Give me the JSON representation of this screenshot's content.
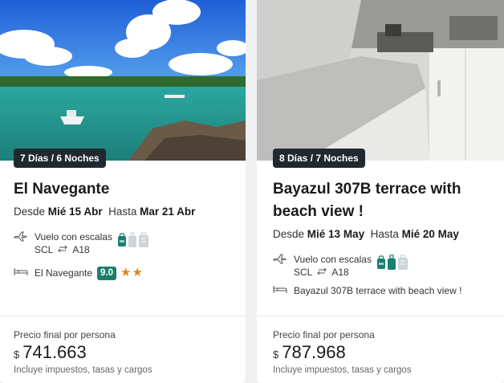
{
  "cards": [
    {
      "badge": "7 Días / 6 Noches",
      "title": "El Navegante",
      "dates": {
        "from_label": "Desde",
        "from_date": "Mié 15 Abr",
        "to_label": "Hasta",
        "to_date": "Mar 21 Abr"
      },
      "flight": {
        "label": "Vuelo con escalas",
        "origin": "SCL",
        "destination": "A18",
        "bags_included": 1,
        "bags_total": 3
      },
      "hotel": {
        "name": "El Navegante",
        "score": "9.0",
        "stars": 2
      },
      "price": {
        "label": "Precio final por persona",
        "currency": "$",
        "amount": "741.663",
        "taxes_note": "Incluye impuestos, tasas y cargos"
      }
    },
    {
      "badge": "8 Días / 7 Noches",
      "title": "Bayazul 307B terrace with beach view !",
      "dates": {
        "from_label": "Desde",
        "from_date": "Mié 13 May",
        "to_label": "Hasta",
        "to_date": "Mié 20 May"
      },
      "flight": {
        "label": "Vuelo con escalas",
        "origin": "SCL",
        "destination": "A18",
        "bags_included": 2,
        "bags_total": 3
      },
      "hotel": {
        "name": "Bayazul 307B terrace with beach view !"
      },
      "price": {
        "label": "Precio final por persona",
        "currency": "$",
        "amount": "787.968",
        "taxes_note": "Incluye impuestos, tasas y cargos"
      }
    }
  ],
  "colors": {
    "badge_bg": "#1f2a30",
    "score_bg": "#1b7f6e",
    "bag_included": "#1b7f6e",
    "bag_excluded": "#cfd4d8",
    "star": "#d88a1a"
  },
  "icons": [
    "plane-icon",
    "roundtrip-arrows-icon",
    "bed-icon",
    "backpack-icon",
    "carry-on-icon",
    "checked-bag-icon",
    "star-icon"
  ]
}
